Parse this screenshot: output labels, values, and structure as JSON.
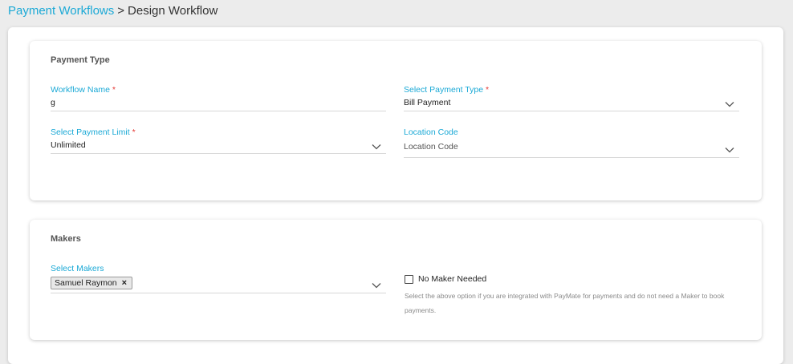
{
  "breadcrumb": {
    "link": "Payment Workflows",
    "separator": ">",
    "current": "Design Workflow"
  },
  "payment_type_section": {
    "title": "Payment Type",
    "workflow_name": {
      "label": "Workflow Name",
      "required_mark": "*",
      "value": "g"
    },
    "payment_type": {
      "label": "Select Payment Type",
      "required_mark": "*",
      "value": "Bill Payment"
    },
    "payment_limit": {
      "label": "Select Payment Limit",
      "required_mark": "*",
      "value": "Unlimited"
    },
    "location_code": {
      "label": "Location Code",
      "placeholder": "Location Code"
    }
  },
  "makers_section": {
    "title": "Makers",
    "select_makers": {
      "label": "Select Makers",
      "chips": [
        {
          "label": "Samuel Raymon",
          "remove_icon": "×"
        }
      ]
    },
    "no_maker": {
      "label": "No Maker Needed",
      "checked": false,
      "help_text": "Select the above option if you are integrated with PayMate for payments and do not need a Maker to book payments."
    }
  },
  "icons": {
    "dropdown": "chevron-down-icon",
    "remove": "close-icon"
  },
  "colors": {
    "accent": "#1ba9d6",
    "required": "#e53935",
    "background": "#ececec"
  }
}
